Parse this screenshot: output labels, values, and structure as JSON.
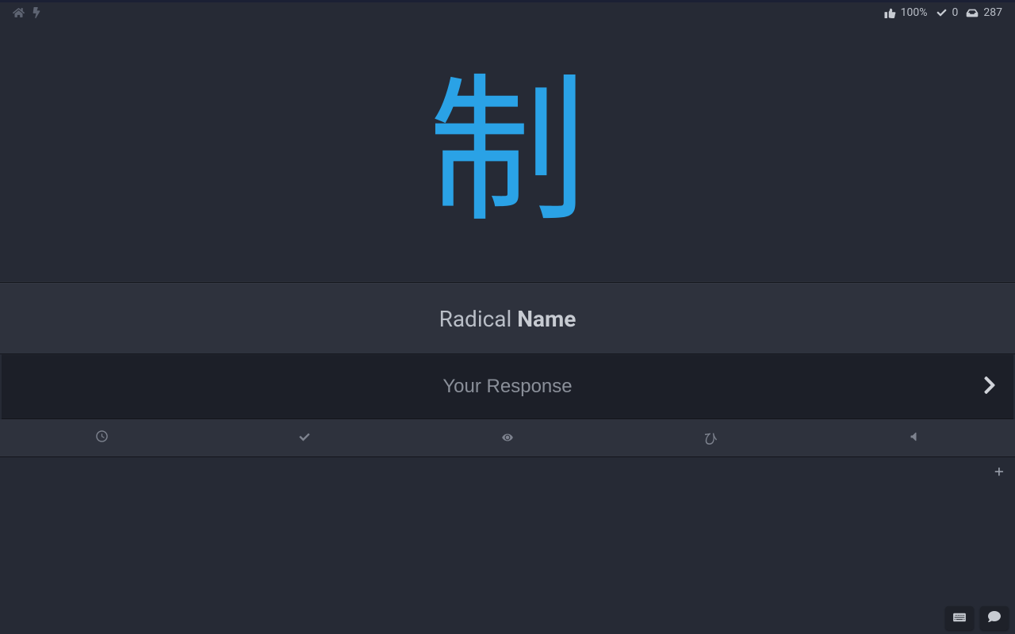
{
  "topbar": {
    "accuracy": "100%",
    "done_count": "0",
    "remaining_count": "287"
  },
  "prompt": {
    "type_label": "Radical",
    "kind_label": "Name"
  },
  "character": "制",
  "input": {
    "placeholder": "Your Response"
  },
  "toolbar": {
    "hiragana_label": "ひ"
  }
}
